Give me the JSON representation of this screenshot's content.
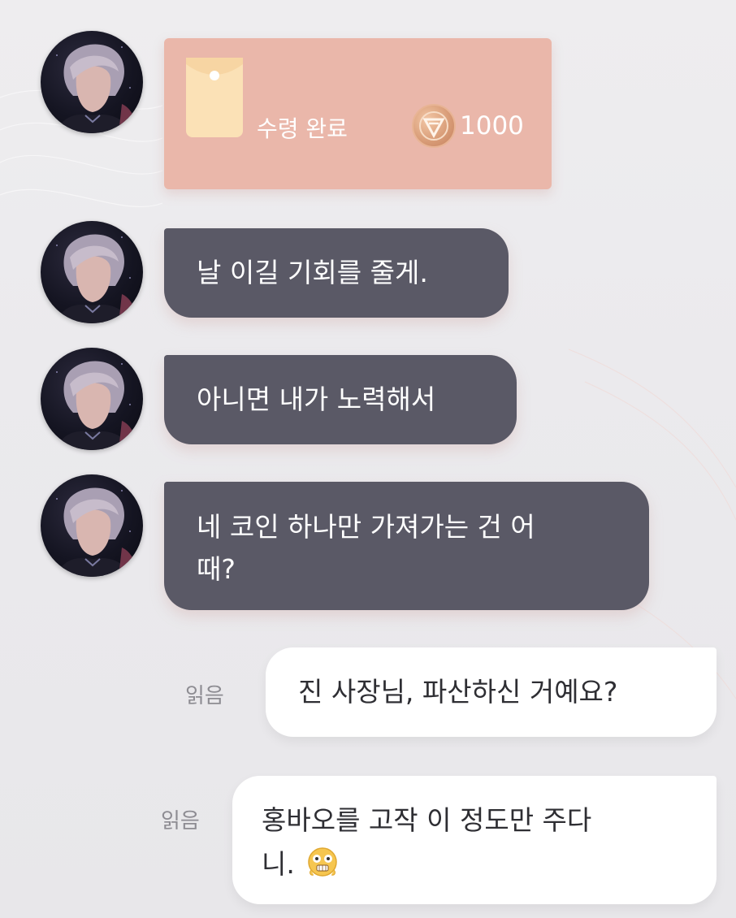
{
  "red_packet": {
    "status": "수령 완료",
    "amount": "1000",
    "envelope_icon": "red-envelope-icon",
    "coin_icon": "coin-icon"
  },
  "messages_in": [
    {
      "text": "날 이길 기회를 줄게."
    },
    {
      "text": "아니면 내가 노력해서"
    },
    {
      "line1": "네 코인 하나만 가져가는 건 어",
      "line2": "때?"
    }
  ],
  "messages_out": [
    {
      "read_label": "읽음",
      "text": "진 사장님, 파산하신 거예요?"
    },
    {
      "read_label": "읽음",
      "line1": "홍바오를 고작 이 정도만 주다",
      "line2": "니.",
      "emoji": "shocked-face-emoji"
    }
  ],
  "colors": {
    "incoming_bubble": "#5a5966",
    "outgoing_bubble": "#ffffff",
    "red_packet": "#eab7aa",
    "envelope": "#fbe1b6"
  }
}
